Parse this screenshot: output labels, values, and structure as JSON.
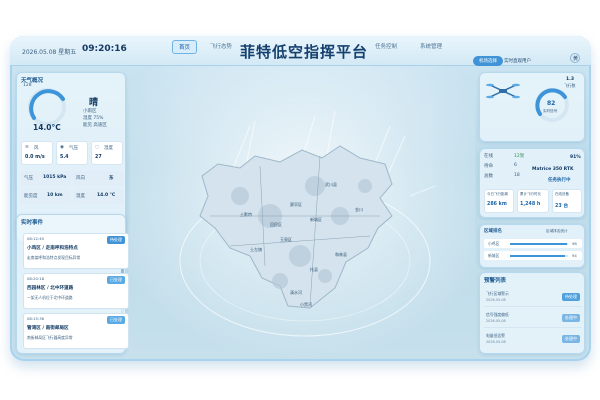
{
  "header": {
    "date": "2026.05.08 星期五",
    "time": "09:20:16",
    "title": "菲特低空指挥平台",
    "nav": [
      {
        "label": "首页",
        "active": true
      },
      {
        "label": "飞行态势"
      },
      {
        "label": "任务控制"
      },
      {
        "label": "系统管理"
      }
    ],
    "pill": "机场选择",
    "user_text": "实时直观用户",
    "user_avatar_label": "黄"
  },
  "weather": {
    "title": "天气概况",
    "gauge_top": "128",
    "temp": "14.0°C",
    "condition": "晴",
    "details": [
      "小雨区",
      "湿度 75%",
      "能见 高速区"
    ],
    "stats": [
      {
        "label": "风",
        "value": "0.0 m/s"
      },
      {
        "label": "气压",
        "value": "5.4"
      },
      {
        "label": "湿度",
        "value": "27"
      }
    ],
    "rows": [
      {
        "k": "气压",
        "v": "1015 kPa"
      },
      {
        "k": "风向",
        "v": "东"
      },
      {
        "k": "能见度",
        "v": "10 km"
      },
      {
        "k": "温度",
        "v": "14.0 °C"
      }
    ]
  },
  "events": {
    "title": "实时事件",
    "items": [
      {
        "time": "08:12:45",
        "title": "小鸡区 / 走南呼和浩特点",
        "desc": "走南某呼和浩特点发现目标异常",
        "tag": "待处理"
      },
      {
        "time": "08:20:18",
        "title": "西园林区 / 北中环道路",
        "desc": "一架无人机位于北中环道路",
        "tag": "已处理"
      },
      {
        "time": "08:15:36",
        "title": "管湾区 / 南街邮局区",
        "desc": "南街邮局区飞行器高度异常",
        "tag": "已处理"
      }
    ]
  },
  "right": {
    "status_val": "1.3",
    "status_unit": "飞行数",
    "gauge_value": "82",
    "gauge_label": "实时信号",
    "cards": [
      {
        "k": "在线",
        "v": "12架"
      },
      {
        "k": "待命",
        "v": "6"
      },
      {
        "k": "总数",
        "v": "18"
      }
    ],
    "signal": "91%",
    "device": "Matrice 350 RTK",
    "device_status": "任务执行中",
    "metrics": [
      {
        "k": "今日飞行距离",
        "v": "286 km"
      },
      {
        "k": "累计飞行时长",
        "v": "1,248 h"
      },
      {
        "k": "在线设备",
        "v": "23 台"
      }
    ],
    "region_title": "区域排名",
    "region_note": "区域排名统计",
    "regions": [
      {
        "name": "小鸡区",
        "val": "98",
        "pct": 0.98
      },
      {
        "name": "新城区",
        "val": "94",
        "pct": 0.94
      },
      {
        "name": "旧城区",
        "val": "82",
        "pct": 0.82
      }
    ],
    "alert_title": "预警列表",
    "alerts": [
      {
        "text": "飞行区域警示",
        "time": "2026-05-08",
        "tag": "待处理"
      },
      {
        "text": "信号强度偏低",
        "time": "2026-05-08",
        "tag": "处理中"
      },
      {
        "text": "电量低告警",
        "time": "2026-05-08",
        "tag": "处理中"
      }
    ]
  },
  "map_labels": [
    "赛罕区",
    "回民区",
    "新城区",
    "玉泉区",
    "托县",
    "土左旗",
    "和林县",
    "武川县",
    "清水河",
    "土默特",
    "金川",
    "小黑河"
  ]
}
